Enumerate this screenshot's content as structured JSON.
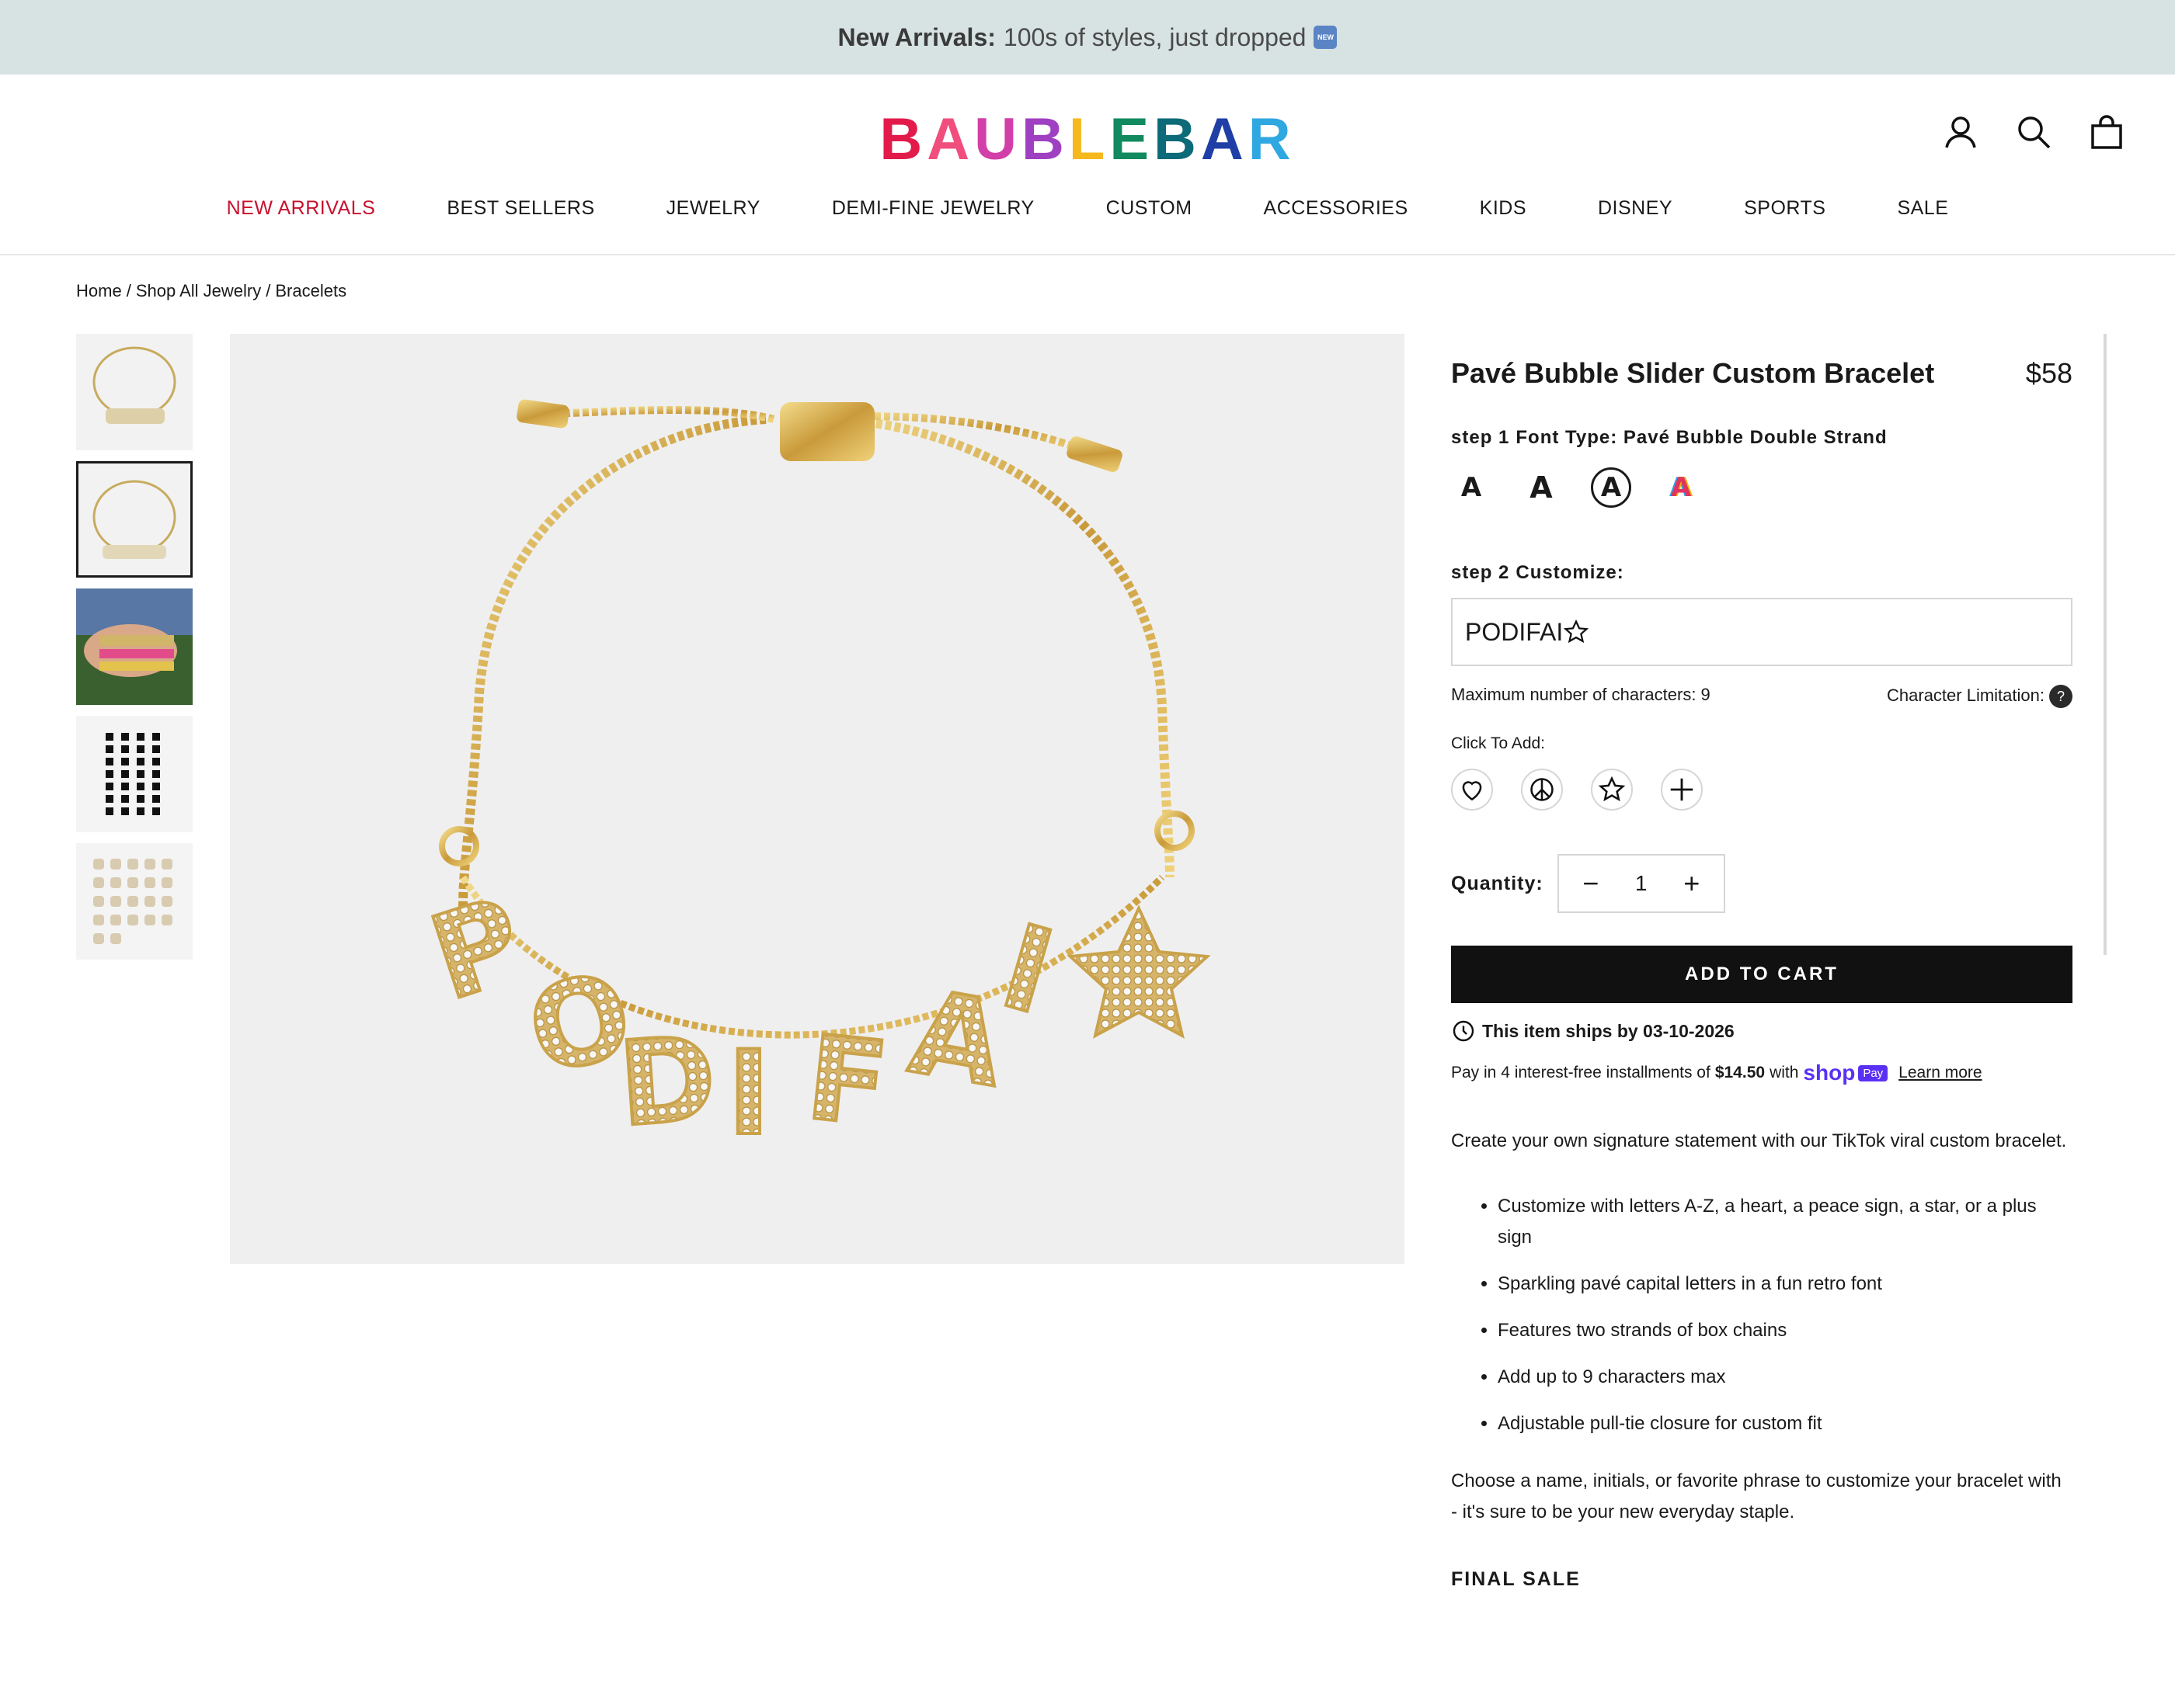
{
  "announcement": {
    "bold": "New Arrivals:",
    "text": "100s of styles, just dropped",
    "badge": "NEW"
  },
  "header": {
    "logo_letters": [
      {
        "char": "B",
        "color": "#e31b4b"
      },
      {
        "char": "A",
        "color": "#f04e7c"
      },
      {
        "char": "U",
        "color": "#d23fa8"
      },
      {
        "char": "B",
        "color": "#9f3fc2"
      },
      {
        "char": "L",
        "color": "#f5b81d"
      },
      {
        "char": "E",
        "color": "#108a5e"
      },
      {
        "char": "B",
        "color": "#0d6a78"
      },
      {
        "char": "A",
        "color": "#1f3fa6"
      },
      {
        "char": "R",
        "color": "#2fa7e0"
      }
    ],
    "icons": [
      "account-icon",
      "search-icon",
      "cart-icon"
    ]
  },
  "nav": [
    {
      "label": "NEW ARRIVALS"
    },
    {
      "label": "BEST SELLERS"
    },
    {
      "label": "JEWELRY"
    },
    {
      "label": "DEMI-FINE JEWELRY"
    },
    {
      "label": "CUSTOM"
    },
    {
      "label": "ACCESSORIES"
    },
    {
      "label": "KIDS"
    },
    {
      "label": "DISNEY"
    },
    {
      "label": "SPORTS"
    },
    {
      "label": "SALE"
    }
  ],
  "breadcrumb": [
    "Home",
    "Shop All Jewelry",
    "Bracelets"
  ],
  "product": {
    "title": "Pavé Bubble Slider Custom Bracelet",
    "price": "$58",
    "step1_tag": "step 1",
    "step1_label": "Font Type: Pavé Bubble Double Strand",
    "font_options": [
      "A",
      "A",
      "A",
      "A"
    ],
    "step2_tag": "step 2",
    "step2_label": "Customize:",
    "custom_text": "PODIFAI",
    "max_chars": "Maximum number of characters: 9",
    "char_limit": "Character Limitation:",
    "help": "?",
    "click_to_add": "Click To Add:",
    "symbols": [
      "heart-icon",
      "peace-icon",
      "star-icon",
      "plus-icon"
    ],
    "quantity_label": "Quantity:",
    "quantity": "1",
    "qty_minus": "−",
    "qty_plus": "+",
    "add_to_cart": "ADD TO CART",
    "ships": "This item ships by 03-10-2026",
    "pay_prefix": "Pay in 4 interest-free installments of",
    "pay_amount": "$14.50",
    "pay_with": "with",
    "shop_brand": "shop",
    "shop_pay": "Pay",
    "learn_more": "Learn more",
    "description": "Create your own signature statement with our TikTok viral custom bracelet.",
    "bullets": [
      "Customize with letters A-Z, a heart, a peace sign, a star, or a plus sign",
      "Sparkling pavé capital letters in a fun retro font",
      "Features two strands of box chains",
      "Add up to 9 characters max",
      "Adjustable pull-tie closure for custom fit"
    ],
    "description2": "Choose a name, initials, or favorite phrase to customize your bracelet with - it's sure to be your new everyday staple.",
    "final_sale": "FINAL SALE"
  },
  "main_image_text": "PODIFAI"
}
